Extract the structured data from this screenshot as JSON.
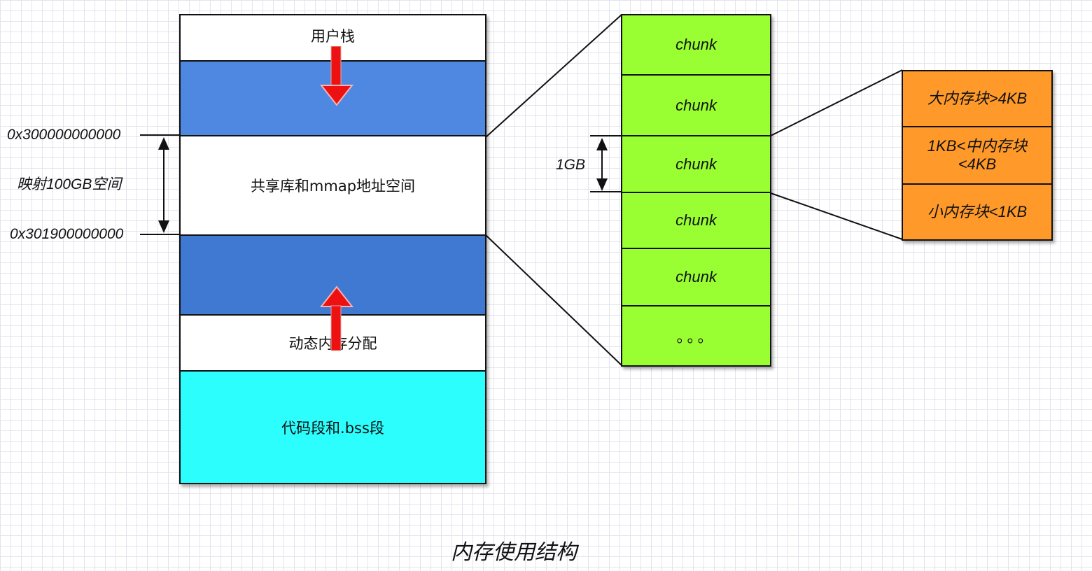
{
  "memory_layout": {
    "user_stack": "用户栈",
    "shared_lib_mmap": "共享库和mmap地址空间",
    "dynamic_alloc": "动态内存分配",
    "code_bss": "代码段和.bss段"
  },
  "addresses": {
    "start": "0x300000000000",
    "end": "0x301900000000",
    "mapping_note": "映射100GB空间"
  },
  "chunks": [
    "chunk",
    "chunk",
    "chunk",
    "chunk",
    "chunk",
    "。。。"
  ],
  "chunk_size_label": "1GB",
  "block_sizes": {
    "large": "大内存块>4KB",
    "medium": "1KB<中内存块\n<4KB",
    "small": "小内存块<1KB"
  },
  "caption": "内存使用结构",
  "colors": {
    "heap_blue": "#4f88e0",
    "heap_blue_lower": "#3f79d2",
    "code_cyan": "#2cfdfd",
    "chunk_green": "#99ff33",
    "size_orange": "#ff9a2a",
    "arrow_red": "#ee1111"
  }
}
